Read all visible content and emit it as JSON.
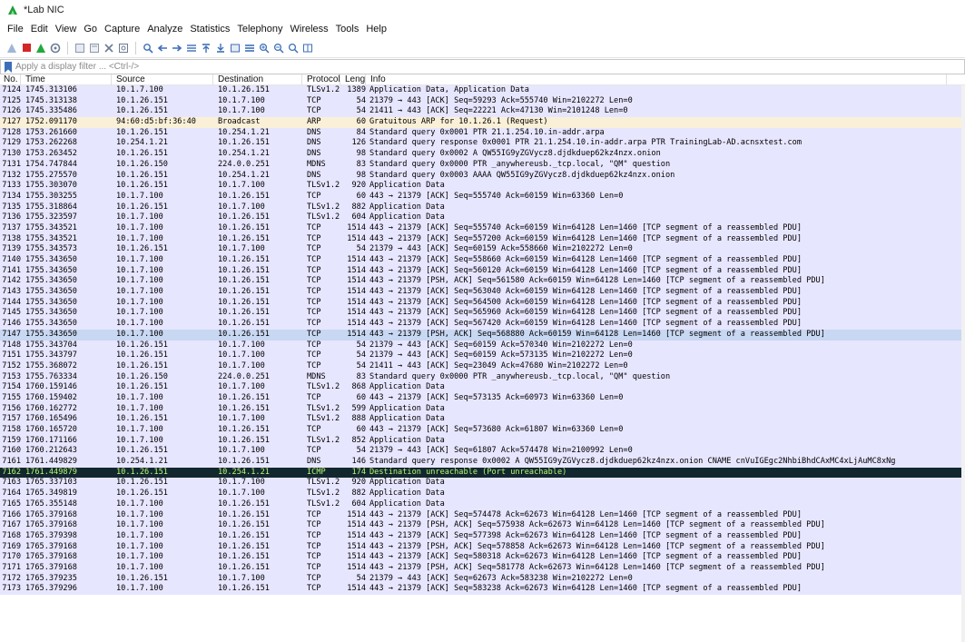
{
  "window": {
    "title": "*Lab NIC"
  },
  "menu": [
    "File",
    "Edit",
    "View",
    "Go",
    "Capture",
    "Analyze",
    "Statistics",
    "Telephony",
    "Wireless",
    "Tools",
    "Help"
  ],
  "filter": {
    "placeholder": "Apply a display filter ... <Ctrl-/>",
    "value": ""
  },
  "columns": [
    "No.",
    "Time",
    "Source",
    "Destination",
    "Protocol",
    "Length",
    "Info"
  ],
  "colors": {
    "row_default": "#e7e6ff",
    "row_arp": "#faf0d7",
    "row_selected": "#c8d7f2",
    "row_icmp_bg": "#12272e",
    "row_icmp_fg": "#b7f774"
  },
  "packets": [
    {
      "no": "7124",
      "time": "1745.313106",
      "src": "10.1.7.100",
      "dst": "10.1.26.151",
      "proto": "TLSv1.2",
      "len": "1389",
      "info": "Application Data, Application Data",
      "style": "tls"
    },
    {
      "no": "7125",
      "time": "1745.313138",
      "src": "10.1.26.151",
      "dst": "10.1.7.100",
      "proto": "TCP",
      "len": "54",
      "info": "21379 → 443 [ACK] Seq=59293 Ack=555740 Win=2102272 Len=0",
      "style": "tcp"
    },
    {
      "no": "7126",
      "time": "1745.335486",
      "src": "10.1.26.151",
      "dst": "10.1.7.100",
      "proto": "TCP",
      "len": "54",
      "info": "21411 → 443 [ACK] Seq=22221 Ack=47130 Win=2101248 Len=0",
      "style": "tcp"
    },
    {
      "no": "7127",
      "time": "1752.091170",
      "src": "94:60:d5:bf:36:40",
      "dst": "Broadcast",
      "proto": "ARP",
      "len": "60",
      "info": "Gratuitous ARP for 10.1.26.1 (Request)",
      "style": "arp"
    },
    {
      "no": "7128",
      "time": "1753.261660",
      "src": "10.1.26.151",
      "dst": "10.254.1.21",
      "proto": "DNS",
      "len": "84",
      "info": "Standard query 0x0001 PTR 21.1.254.10.in-addr.arpa",
      "style": "dns"
    },
    {
      "no": "7129",
      "time": "1753.262268",
      "src": "10.254.1.21",
      "dst": "10.1.26.151",
      "proto": "DNS",
      "len": "126",
      "info": "Standard query response 0x0001 PTR 21.1.254.10.in-addr.arpa PTR TrainingLab-AD.acnsxtest.com",
      "style": "dns"
    },
    {
      "no": "7130",
      "time": "1753.263452",
      "src": "10.1.26.151",
      "dst": "10.254.1.21",
      "proto": "DNS",
      "len": "98",
      "info": "Standard query 0x0002 A QW55IG9yZGVycz8.djdkduep62kz4nzx.onion",
      "style": "dns"
    },
    {
      "no": "7131",
      "time": "1754.747844",
      "src": "10.1.26.150",
      "dst": "224.0.0.251",
      "proto": "MDNS",
      "len": "83",
      "info": "Standard query 0x0000 PTR _anywhereusb._tcp.local, \"QM\" question",
      "style": "mdns"
    },
    {
      "no": "7132",
      "time": "1755.275570",
      "src": "10.1.26.151",
      "dst": "10.254.1.21",
      "proto": "DNS",
      "len": "98",
      "info": "Standard query 0x0003 AAAA QW55IG9yZGVycz8.djdkduep62kz4nzx.onion",
      "style": "dns"
    },
    {
      "no": "7133",
      "time": "1755.303070",
      "src": "10.1.26.151",
      "dst": "10.1.7.100",
      "proto": "TLSv1.2",
      "len": "920",
      "info": "Application Data",
      "style": "tls"
    },
    {
      "no": "7134",
      "time": "1755.303255",
      "src": "10.1.7.100",
      "dst": "10.1.26.151",
      "proto": "TCP",
      "len": "60",
      "info": "443 → 21379 [ACK] Seq=555740 Ack=60159 Win=63360 Len=0",
      "style": "tcp"
    },
    {
      "no": "7135",
      "time": "1755.318864",
      "src": "10.1.26.151",
      "dst": "10.1.7.100",
      "proto": "TLSv1.2",
      "len": "882",
      "info": "Application Data",
      "style": "tls"
    },
    {
      "no": "7136",
      "time": "1755.323597",
      "src": "10.1.7.100",
      "dst": "10.1.26.151",
      "proto": "TLSv1.2",
      "len": "604",
      "info": "Application Data",
      "style": "tls"
    },
    {
      "no": "7137",
      "time": "1755.343521",
      "src": "10.1.7.100",
      "dst": "10.1.26.151",
      "proto": "TCP",
      "len": "1514",
      "info": "443 → 21379 [ACK] Seq=555740 Ack=60159 Win=64128 Len=1460 [TCP segment of a reassembled PDU]",
      "style": "tcp"
    },
    {
      "no": "7138",
      "time": "1755.343521",
      "src": "10.1.7.100",
      "dst": "10.1.26.151",
      "proto": "TCP",
      "len": "1514",
      "info": "443 → 21379 [ACK] Seq=557200 Ack=60159 Win=64128 Len=1460 [TCP segment of a reassembled PDU]",
      "style": "tcp"
    },
    {
      "no": "7139",
      "time": "1755.343573",
      "src": "10.1.26.151",
      "dst": "10.1.7.100",
      "proto": "TCP",
      "len": "54",
      "info": "21379 → 443 [ACK] Seq=60159 Ack=558660 Win=2102272 Len=0",
      "style": "tcp"
    },
    {
      "no": "7140",
      "time": "1755.343650",
      "src": "10.1.7.100",
      "dst": "10.1.26.151",
      "proto": "TCP",
      "len": "1514",
      "info": "443 → 21379 [ACK] Seq=558660 Ack=60159 Win=64128 Len=1460 [TCP segment of a reassembled PDU]",
      "style": "tcp"
    },
    {
      "no": "7141",
      "time": "1755.343650",
      "src": "10.1.7.100",
      "dst": "10.1.26.151",
      "proto": "TCP",
      "len": "1514",
      "info": "443 → 21379 [ACK] Seq=560120 Ack=60159 Win=64128 Len=1460 [TCP segment of a reassembled PDU]",
      "style": "tcp"
    },
    {
      "no": "7142",
      "time": "1755.343650",
      "src": "10.1.7.100",
      "dst": "10.1.26.151",
      "proto": "TCP",
      "len": "1514",
      "info": "443 → 21379 [PSH, ACK] Seq=561580 Ack=60159 Win=64128 Len=1460 [TCP segment of a reassembled PDU]",
      "style": "tcp"
    },
    {
      "no": "7143",
      "time": "1755.343650",
      "src": "10.1.7.100",
      "dst": "10.1.26.151",
      "proto": "TCP",
      "len": "1514",
      "info": "443 → 21379 [ACK] Seq=563040 Ack=60159 Win=64128 Len=1460 [TCP segment of a reassembled PDU]",
      "style": "tcp"
    },
    {
      "no": "7144",
      "time": "1755.343650",
      "src": "10.1.7.100",
      "dst": "10.1.26.151",
      "proto": "TCP",
      "len": "1514",
      "info": "443 → 21379 [ACK] Seq=564500 Ack=60159 Win=64128 Len=1460 [TCP segment of a reassembled PDU]",
      "style": "tcp"
    },
    {
      "no": "7145",
      "time": "1755.343650",
      "src": "10.1.7.100",
      "dst": "10.1.26.151",
      "proto": "TCP",
      "len": "1514",
      "info": "443 → 21379 [ACK] Seq=565960 Ack=60159 Win=64128 Len=1460 [TCP segment of a reassembled PDU]",
      "style": "tcp"
    },
    {
      "no": "7146",
      "time": "1755.343650",
      "src": "10.1.7.100",
      "dst": "10.1.26.151",
      "proto": "TCP",
      "len": "1514",
      "info": "443 → 21379 [ACK] Seq=567420 Ack=60159 Win=64128 Len=1460 [TCP segment of a reassembled PDU]",
      "style": "tcp"
    },
    {
      "no": "7147",
      "time": "1755.343650",
      "src": "10.1.7.100",
      "dst": "10.1.26.151",
      "proto": "TCP",
      "len": "1514",
      "info": "443 → 21379 [PSH, ACK] Seq=568880 Ack=60159 Win=64128 Len=1460 [TCP segment of a reassembled PDU]",
      "style": "sel"
    },
    {
      "no": "7148",
      "time": "1755.343704",
      "src": "10.1.26.151",
      "dst": "10.1.7.100",
      "proto": "TCP",
      "len": "54",
      "info": "21379 → 443 [ACK] Seq=60159 Ack=570340 Win=2102272 Len=0",
      "style": "tcp"
    },
    {
      "no": "7151",
      "time": "1755.343797",
      "src": "10.1.26.151",
      "dst": "10.1.7.100",
      "proto": "TCP",
      "len": "54",
      "info": "21379 → 443 [ACK] Seq=60159 Ack=573135 Win=2102272 Len=0",
      "style": "tcp"
    },
    {
      "no": "7152",
      "time": "1755.368072",
      "src": "10.1.26.151",
      "dst": "10.1.7.100",
      "proto": "TCP",
      "len": "54",
      "info": "21411 → 443 [ACK] Seq=23049 Ack=47680 Win=2102272 Len=0",
      "style": "tcp"
    },
    {
      "no": "7153",
      "time": "1755.763334",
      "src": "10.1.26.150",
      "dst": "224.0.0.251",
      "proto": "MDNS",
      "len": "83",
      "info": "Standard query 0x0000 PTR _anywhereusb._tcp.local, \"QM\" question",
      "style": "mdns"
    },
    {
      "no": "7154",
      "time": "1760.159146",
      "src": "10.1.26.151",
      "dst": "10.1.7.100",
      "proto": "TLSv1.2",
      "len": "868",
      "info": "Application Data",
      "style": "tls"
    },
    {
      "no": "7155",
      "time": "1760.159402",
      "src": "10.1.7.100",
      "dst": "10.1.26.151",
      "proto": "TCP",
      "len": "60",
      "info": "443 → 21379 [ACK] Seq=573135 Ack=60973 Win=63360 Len=0",
      "style": "tcp"
    },
    {
      "no": "7156",
      "time": "1760.162772",
      "src": "10.1.7.100",
      "dst": "10.1.26.151",
      "proto": "TLSv1.2",
      "len": "599",
      "info": "Application Data",
      "style": "tls"
    },
    {
      "no": "7157",
      "time": "1760.165496",
      "src": "10.1.26.151",
      "dst": "10.1.7.100",
      "proto": "TLSv1.2",
      "len": "888",
      "info": "Application Data",
      "style": "tls"
    },
    {
      "no": "7158",
      "time": "1760.165720",
      "src": "10.1.7.100",
      "dst": "10.1.26.151",
      "proto": "TCP",
      "len": "60",
      "info": "443 → 21379 [ACK] Seq=573680 Ack=61807 Win=63360 Len=0",
      "style": "tcp"
    },
    {
      "no": "7159",
      "time": "1760.171166",
      "src": "10.1.7.100",
      "dst": "10.1.26.151",
      "proto": "TLSv1.2",
      "len": "852",
      "info": "Application Data",
      "style": "tls"
    },
    {
      "no": "7160",
      "time": "1760.212643",
      "src": "10.1.26.151",
      "dst": "10.1.7.100",
      "proto": "TCP",
      "len": "54",
      "info": "21379 → 443 [ACK] Seq=61807 Ack=574478 Win=2100992 Len=0",
      "style": "tcp"
    },
    {
      "no": "7161",
      "time": "1761.449829",
      "src": "10.254.1.21",
      "dst": "10.1.26.151",
      "proto": "DNS",
      "len": "146",
      "info": "Standard query response 0x0002 A QW55IG9yZGVycz8.djdkduep62kz4nzx.onion CNAME cnVuIGEgc2NhbiBhdCAxMC4xLjAuMC8xNg",
      "style": "dns"
    },
    {
      "no": "7162",
      "time": "1761.449879",
      "src": "10.1.26.151",
      "dst": "10.254.1.21",
      "proto": "ICMP",
      "len": "174",
      "info": "Destination unreachable (Port unreachable)",
      "style": "icmp"
    },
    {
      "no": "7163",
      "time": "1765.337103",
      "src": "10.1.26.151",
      "dst": "10.1.7.100",
      "proto": "TLSv1.2",
      "len": "920",
      "info": "Application Data",
      "style": "tls"
    },
    {
      "no": "7164",
      "time": "1765.349819",
      "src": "10.1.26.151",
      "dst": "10.1.7.100",
      "proto": "TLSv1.2",
      "len": "882",
      "info": "Application Data",
      "style": "tls"
    },
    {
      "no": "7165",
      "time": "1765.355148",
      "src": "10.1.7.100",
      "dst": "10.1.26.151",
      "proto": "TLSv1.2",
      "len": "604",
      "info": "Application Data",
      "style": "tls"
    },
    {
      "no": "7166",
      "time": "1765.379168",
      "src": "10.1.7.100",
      "dst": "10.1.26.151",
      "proto": "TCP",
      "len": "1514",
      "info": "443 → 21379 [ACK] Seq=574478 Ack=62673 Win=64128 Len=1460 [TCP segment of a reassembled PDU]",
      "style": "tcp"
    },
    {
      "no": "7167",
      "time": "1765.379168",
      "src": "10.1.7.100",
      "dst": "10.1.26.151",
      "proto": "TCP",
      "len": "1514",
      "info": "443 → 21379 [PSH, ACK] Seq=575938 Ack=62673 Win=64128 Len=1460 [TCP segment of a reassembled PDU]",
      "style": "tcp"
    },
    {
      "no": "7168",
      "time": "1765.379398",
      "src": "10.1.7.100",
      "dst": "10.1.26.151",
      "proto": "TCP",
      "len": "1514",
      "info": "443 → 21379 [ACK] Seq=577398 Ack=62673 Win=64128 Len=1460 [TCP segment of a reassembled PDU]",
      "style": "tcp"
    },
    {
      "no": "7169",
      "time": "1765.379168",
      "src": "10.1.7.100",
      "dst": "10.1.26.151",
      "proto": "TCP",
      "len": "1514",
      "info": "443 → 21379 [PSH, ACK] Seq=578858 Ack=62673 Win=64128 Len=1460 [TCP segment of a reassembled PDU]",
      "style": "tcp"
    },
    {
      "no": "7170",
      "time": "1765.379168",
      "src": "10.1.7.100",
      "dst": "10.1.26.151",
      "proto": "TCP",
      "len": "1514",
      "info": "443 → 21379 [ACK] Seq=580318 Ack=62673 Win=64128 Len=1460 [TCP segment of a reassembled PDU]",
      "style": "tcp"
    },
    {
      "no": "7171",
      "time": "1765.379168",
      "src": "10.1.7.100",
      "dst": "10.1.26.151",
      "proto": "TCP",
      "len": "1514",
      "info": "443 → 21379 [PSH, ACK] Seq=581778 Ack=62673 Win=64128 Len=1460 [TCP segment of a reassembled PDU]",
      "style": "tcp"
    },
    {
      "no": "7172",
      "time": "1765.379235",
      "src": "10.1.26.151",
      "dst": "10.1.7.100",
      "proto": "TCP",
      "len": "54",
      "info": "21379 → 443 [ACK] Seq=62673 Ack=583238 Win=2102272 Len=0",
      "style": "tcp"
    },
    {
      "no": "7173",
      "time": "1765.379296",
      "src": "10.1.7.100",
      "dst": "10.1.26.151",
      "proto": "TCP",
      "len": "1514",
      "info": "443 → 21379 [ACK] Seq=583238 Ack=62673 Win=64128 Len=1460 [TCP segment of a reassembled PDU]",
      "style": "tcp"
    }
  ]
}
